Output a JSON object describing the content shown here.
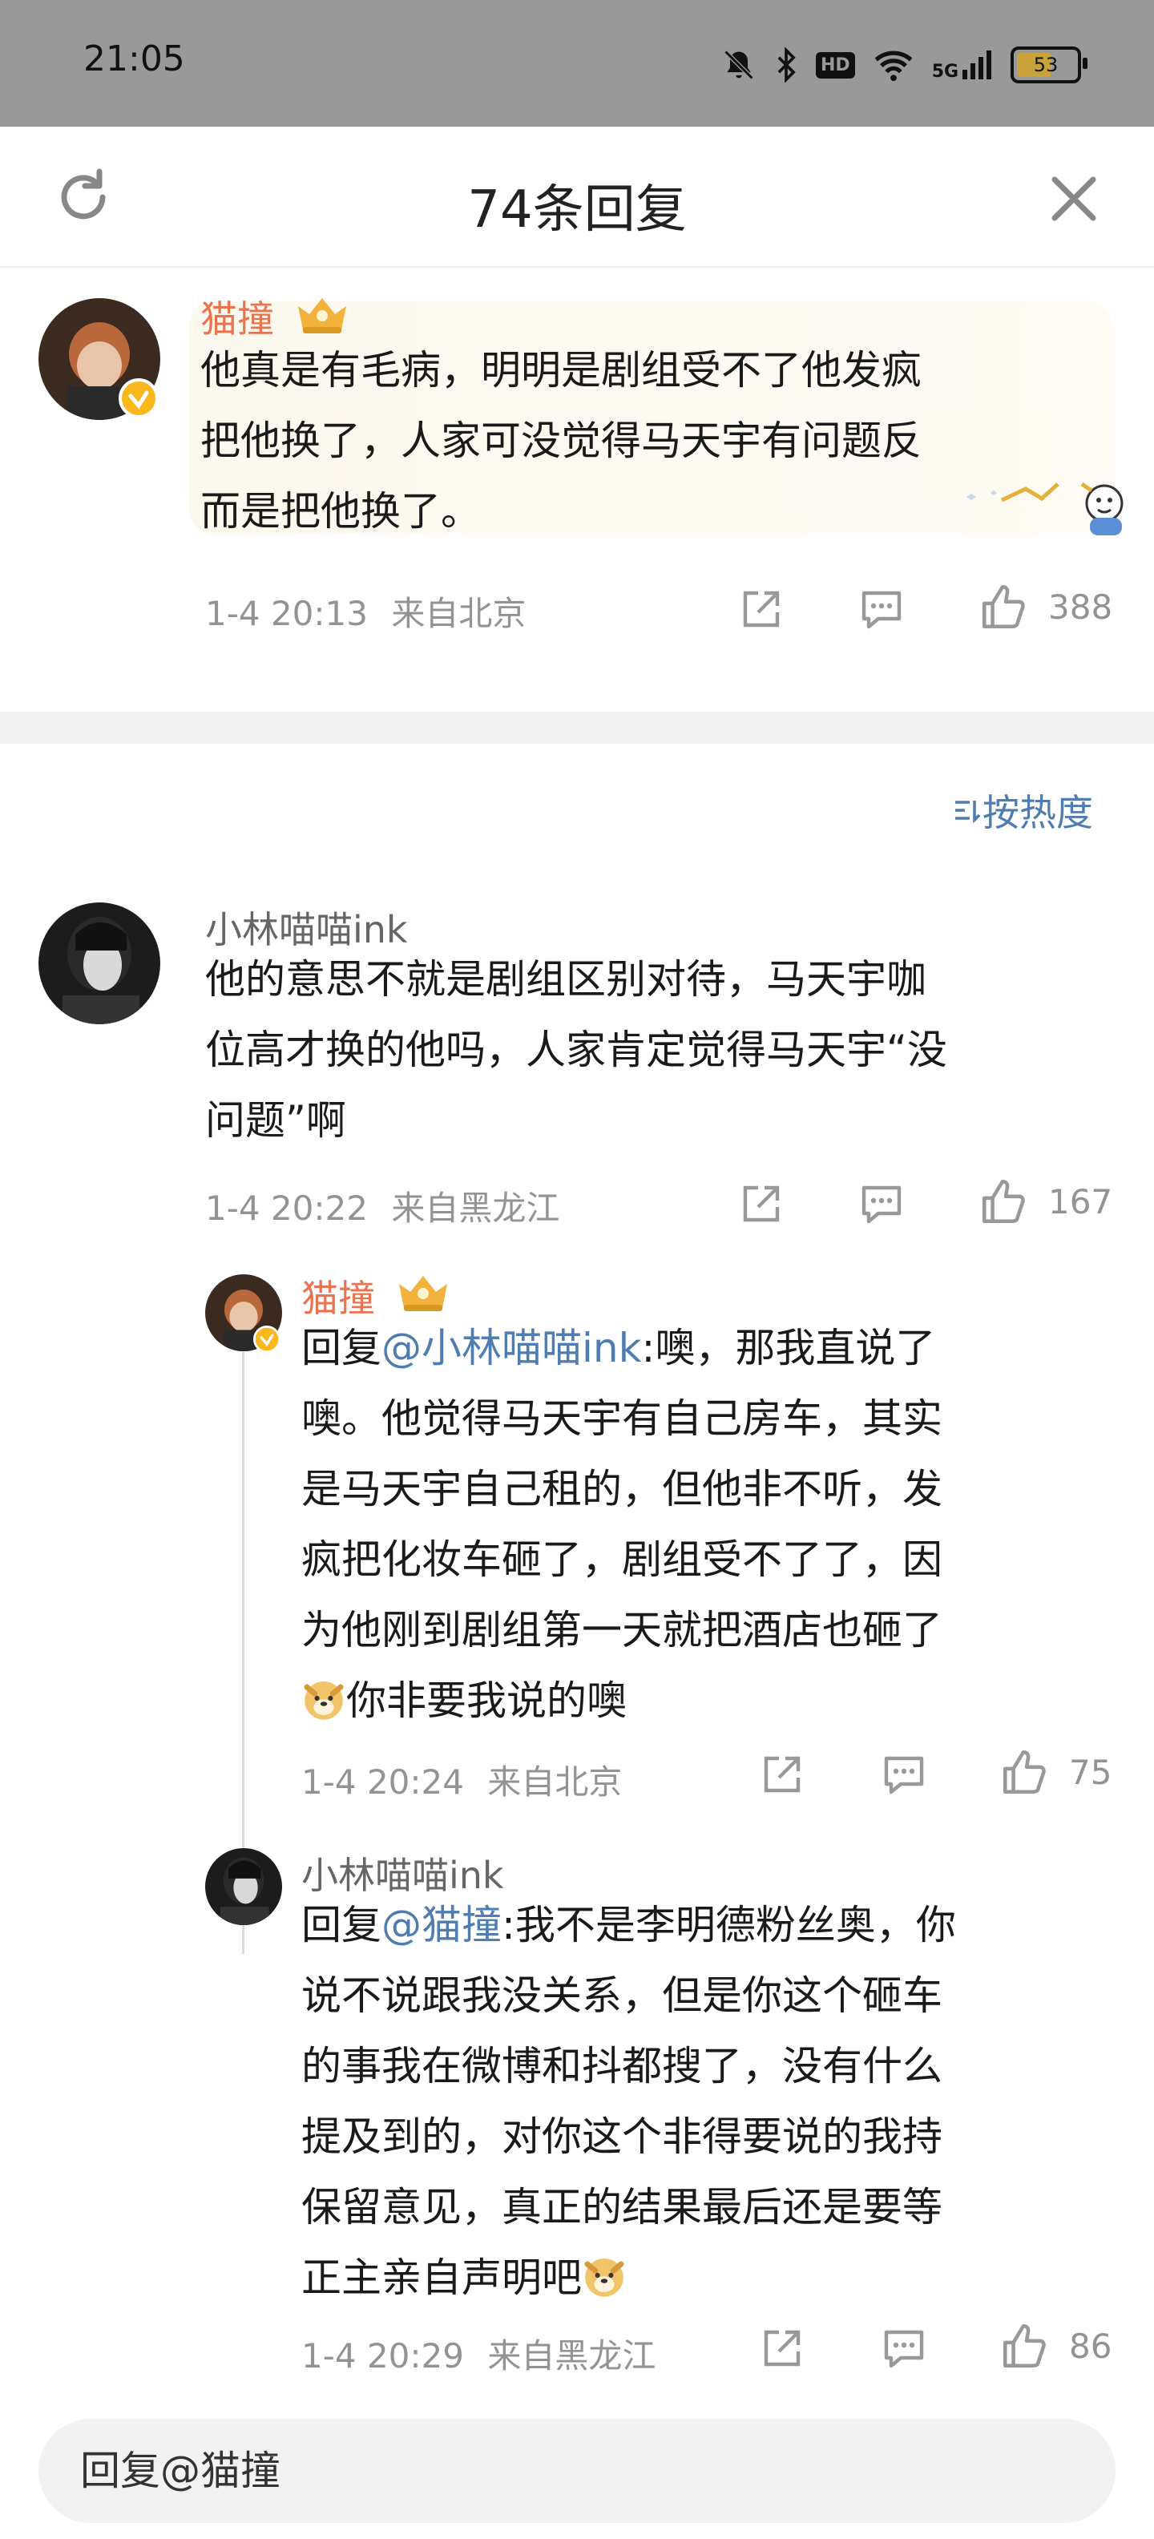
{
  "status_bar": {
    "time": "21:05",
    "network": "5G",
    "battery": "53",
    "hd": "HD"
  },
  "header": {
    "title": "74条回复"
  },
  "root_comment": {
    "user": "猫撞",
    "text": "他真是有毛病，明明是剧组受不了他发疯把他换了，人家可没觉得马天宇有问题反而是把他换了。",
    "lines": [
      "他真是有毛病，明明是剧组受不了他发疯",
      "把他换了，人家可没觉得马天宇有问题反",
      "而是把他换了。"
    ],
    "time": "1-4 20:13",
    "location": "来自北京",
    "likes": "388"
  },
  "sort_label": "按热度",
  "comments": [
    {
      "user": "小林喵喵ink",
      "lines": [
        "他的意思不就是剧组区别对待，马天宇咖",
        "位高才换的他吗，人家肯定觉得马天宇“没",
        "问题”啊"
      ],
      "time": "1-4 20:22",
      "location": "来自黑龙江",
      "likes": "167"
    }
  ],
  "replies": [
    {
      "user": "猫撞",
      "reply_prefix": "回复",
      "reply_to": "@小林喵喵ink",
      "lines": [
        ":噢，那我直说了",
        "噢。他觉得马天宇有自己房车，其实",
        "是马天宇自己租的，但他非不听，发",
        "疯把化妆车砸了，剧组受不了了，因",
        "为他刚到剧组第一天就把酒店也砸了",
        "你非要我说的噢"
      ],
      "time": "1-4 20:24",
      "location": "来自北京",
      "likes": "75"
    },
    {
      "user": "小林喵喵ink",
      "reply_prefix": "回复",
      "reply_to": "@猫撞",
      "lines": [
        ":我不是李明德粉丝奥，你",
        "说不说跟我没关系，但是你这个砸车",
        "的事我在微博和抖都搜了，没有什么",
        "提及到的，对你这个非得要说的我持",
        "保留意见，真正的结果最后还是要等",
        "正主亲自声明吧"
      ],
      "time": "1-4 20:29",
      "location": "来自黑龙江",
      "likes": "86"
    }
  ],
  "reply_bar": {
    "placeholder": "回复@猫撞"
  },
  "icons": [
    "refresh-icon",
    "close-icon",
    "share-icon",
    "comment-icon",
    "like-icon",
    "verified-icon",
    "crown-icon",
    "doge-emoji",
    "sort-icon"
  ],
  "colors": {
    "username_vip": "#eb7350",
    "link": "#507daf",
    "meta": "#939393",
    "status_bar": "#999999"
  }
}
